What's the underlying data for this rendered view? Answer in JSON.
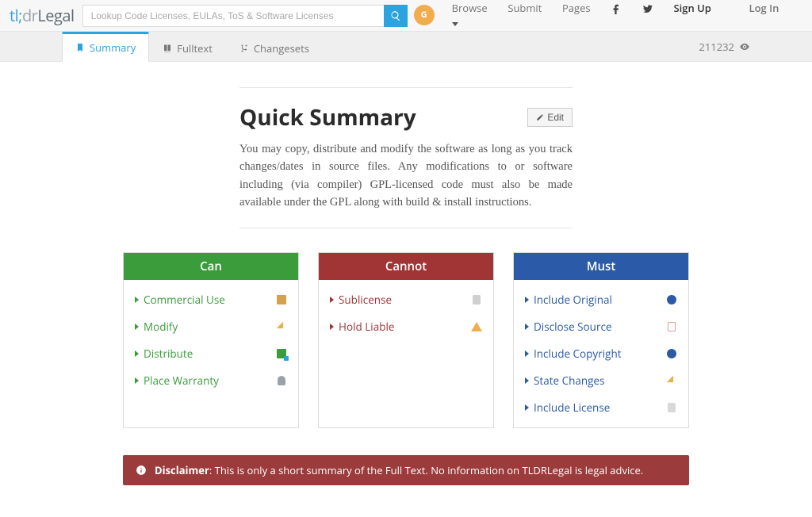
{
  "logo": {
    "tl": "tl;",
    "dr": "dr",
    "legal": "Legal"
  },
  "search": {
    "placeholder": "Lookup Code Licenses, EULAs, ToS & Software Licenses"
  },
  "nav": {
    "browse": "Browse",
    "submit": "Submit",
    "pages": "Pages",
    "sign_up": "Sign Up",
    "log_in": "Log In"
  },
  "tabs": {
    "summary": "Summary",
    "fulltext": "Fulltext",
    "changesets": "Changesets"
  },
  "views": "211232",
  "summary": {
    "title": "Quick Summary",
    "edit": "Edit",
    "body": "You may copy, distribute and modify the software as long as you track changes/dates in source files. Any modifications to or software including (via compiler) GPL-licensed code must also be made available under the GPL along with build & install instructions."
  },
  "columns": {
    "can": {
      "title": "Can",
      "items": [
        "Commercial Use",
        "Modify",
        "Distribute",
        "Place Warranty"
      ]
    },
    "cannot": {
      "title": "Cannot",
      "items": [
        "Sublicense",
        "Hold Liable"
      ]
    },
    "must": {
      "title": "Must",
      "items": [
        "Include Original",
        "Disclose Source",
        "Include Copyright",
        "State Changes",
        "Include License"
      ]
    }
  },
  "disclaimer": {
    "label": "Disclaimer",
    "text": ": This is only a short summary of the Full Text. No information on TLDRLegal is legal advice."
  }
}
